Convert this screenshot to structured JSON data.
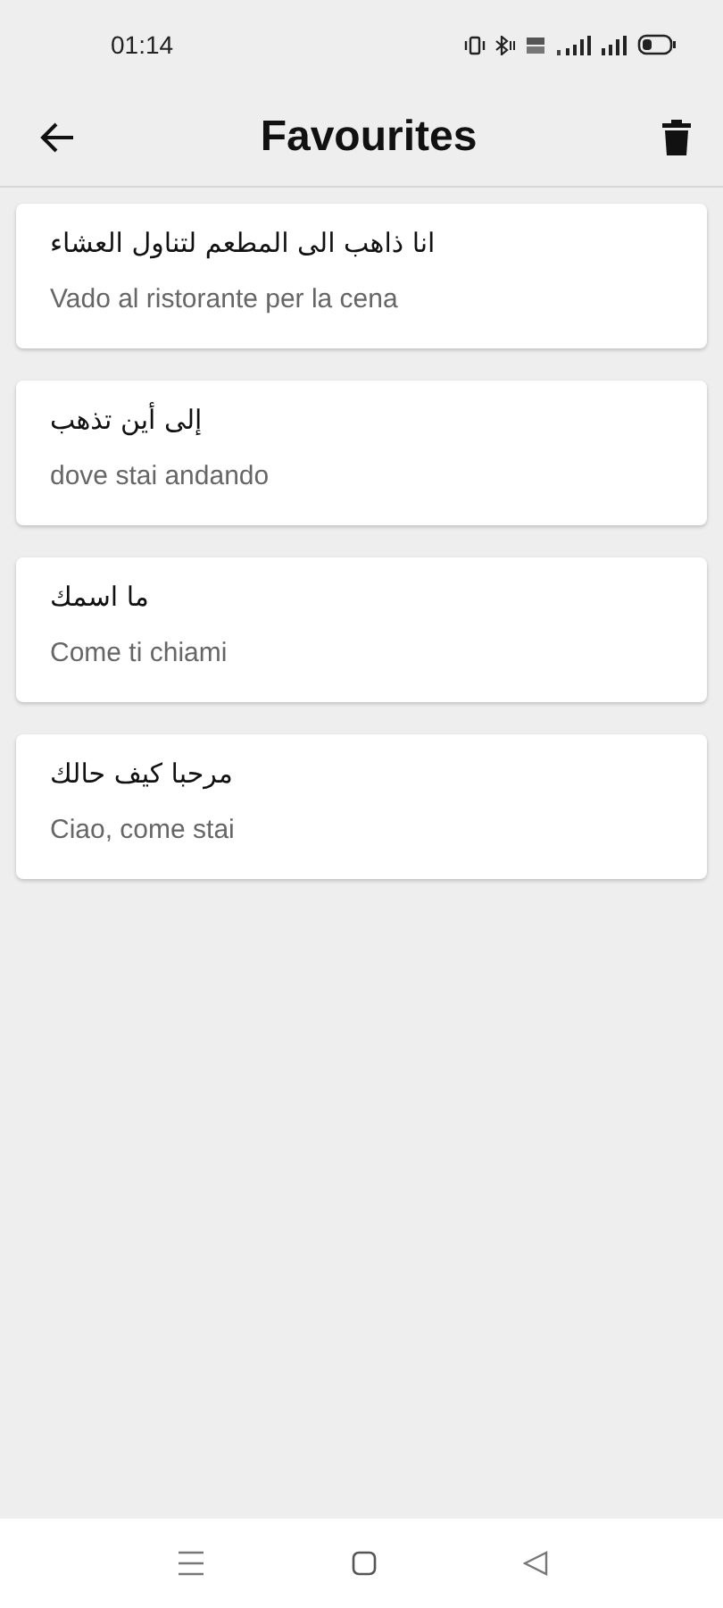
{
  "status_bar": {
    "time": "01:14"
  },
  "app_bar": {
    "title": "Favourites"
  },
  "favourites": [
    {
      "arabic": "انا ذاهب الى المطعم لتناول العشاء",
      "italian": "Vado al ristorante per la cena"
    },
    {
      "arabic": "إلى أين تذهب",
      "italian": "dove stai andando"
    },
    {
      "arabic": "ما اسمك",
      "italian": "Come ti chiami"
    },
    {
      "arabic": "مرحبا كيف حالك",
      "italian": "Ciao, come stai"
    }
  ]
}
